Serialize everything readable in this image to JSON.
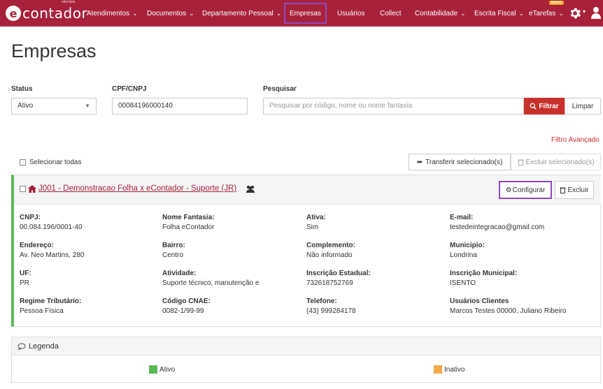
{
  "nav": {
    "logo_text": "contador",
    "logo_small": "alterdata",
    "items": [
      {
        "label": "Atendimentos",
        "dropdown": true
      },
      {
        "label": "Documentos",
        "dropdown": true
      },
      {
        "label": "Departamento Pessoal",
        "dropdown": true
      },
      {
        "label": "Empresas",
        "dropdown": false,
        "active": true
      },
      {
        "label": "Usuários",
        "dropdown": false
      },
      {
        "label": "Collect",
        "dropdown": false
      },
      {
        "label": "Contabilidade",
        "dropdown": true
      },
      {
        "label": "Escrita Fiscal",
        "dropdown": true
      },
      {
        "label": "eTarefas",
        "dropdown": true
      }
    ],
    "new_badge": "NOVO",
    "icons": [
      "gear-icon",
      "user-icon"
    ]
  },
  "page": {
    "title": "Empresas"
  },
  "filters": {
    "status_label": "Status",
    "status_value": "Ativo",
    "cnpj_label": "CPF/CNPJ",
    "cnpj_value": "00084196000140",
    "search_label": "Pesquisar",
    "search_placeholder": "Pesquisar por código, nome ou nome fantasia",
    "filter_button": "Filtrar",
    "clear_button": "Limpar",
    "advanced_link": "Filtro Avançado"
  },
  "bulk": {
    "select_all": "Selecionar todas",
    "transfer": "Transferir selecionado(s)",
    "delete_selected": "Excluir selecionado(s)"
  },
  "company": {
    "title": "J001 - Demonstracao Folha x eContador - Suporte (JR)",
    "configure": "Configurar",
    "delete": "Excluir",
    "status_color": "#5cb85c",
    "fields": [
      {
        "label": "CNPJ:",
        "value": "00.084.196/0001-40"
      },
      {
        "label": "Nome Fantasia:",
        "value": "Folha eContador"
      },
      {
        "label": "Ativa:",
        "value": "Sim"
      },
      {
        "label": "E-mail:",
        "value": "testedeintegracao@gmail.com"
      },
      {
        "label": "Endereço:",
        "value": "Av. Neo Martins, 280"
      },
      {
        "label": "Bairro:",
        "value": "Centro"
      },
      {
        "label": "Complemento:",
        "value": "Não informado"
      },
      {
        "label": "Municipio:",
        "value": "Londrina"
      },
      {
        "label": "UF:",
        "value": "PR"
      },
      {
        "label": "Atividade:",
        "value": "Suporte técnico, manutenção e"
      },
      {
        "label": "Inscrição Estadual:",
        "value": "732618752769"
      },
      {
        "label": "Inscrição Municipal:",
        "value": "ISENTO"
      },
      {
        "label": "Regime Tributário:",
        "value": "Pessoa Física"
      },
      {
        "label": "Código CNAE:",
        "value": "0082-1/99-99"
      },
      {
        "label": "Telefone:",
        "value": "(43) 999284178"
      },
      {
        "label": "Usuários Clientes",
        "value": "Marcos Testes 00000, Juliano Ribeiro"
      }
    ]
  },
  "legend": {
    "title": "Legenda",
    "items": [
      {
        "label": "Ativo",
        "color": "#5cb85c"
      },
      {
        "label": "Inativo",
        "color": "#f0ad4e"
      }
    ]
  },
  "colors": {
    "brand": "#a8213b",
    "highlight": "#8e4ac2",
    "danger": "#c9302c"
  }
}
